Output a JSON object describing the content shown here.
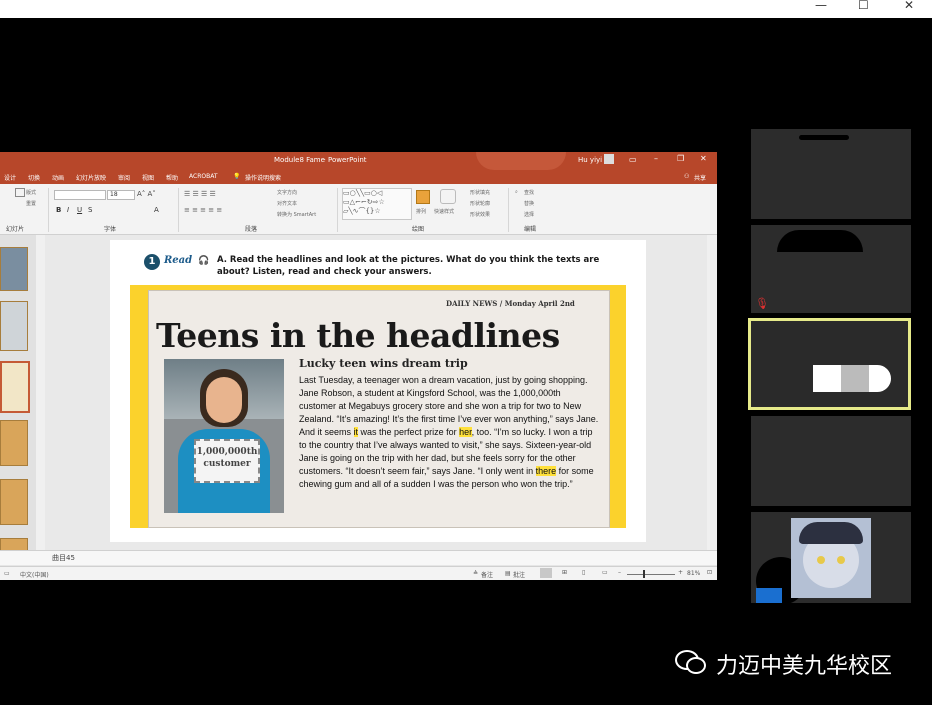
{
  "window": {
    "minimize": "—",
    "maximize": "☐",
    "close": "✕"
  },
  "ppt": {
    "filename": "Module8 Fame",
    "app": "PowerPoint",
    "user": "Hu yiyi",
    "menu": [
      "设计",
      "切换",
      "动画",
      "幻灯片放映",
      "审阅",
      "视图",
      "帮助",
      "ACROBAT"
    ],
    "tell_me": "操作说明搜索",
    "share": "共享",
    "ribbon": {
      "group_slides": "幻灯片",
      "group_font": "字体",
      "group_paragraph": "段落",
      "group_drawing": "绘图",
      "group_editing": "编辑",
      "layout": "版式",
      "reset": "重置",
      "font_size": "18",
      "text_direction": "文字方向",
      "align_text": "对齐文本",
      "convert_smartart": "转换为 SmartArt",
      "arrange": "排列",
      "quick_styles": "快速样式",
      "shape_fill": "形状填充",
      "shape_outline": "形状轮廓",
      "shape_effects": "形状效果",
      "find": "查找",
      "replace": "替换",
      "select": "选择"
    },
    "notes": "曲目45",
    "status_lang": "中文(中国)",
    "status_notes": "备注",
    "status_comments": "批注",
    "zoom": "81%"
  },
  "slide": {
    "number": "1",
    "read": "Read",
    "instruction": "A. Read the headlines and look at the pictures. What do you think the texts are about? Listen, read and check your answers.",
    "dateline": "DAILY NEWS / Monday April 2nd",
    "headline": "Teens in the headlines",
    "sign_line1": "1,000,000th",
    "sign_line2": "customer",
    "story_title": "Lucky teen wins dream trip",
    "story_a": "Last Tuesday, a teenager won a dream vacation, just by going shopping. Jane Robson, a student at Kingsford School, was the 1,000,000th customer at Megabuys grocery store and she won a trip for two to New Zealand. “It’s amazing! It’s the first time I’ve ever won anything,” says Jane. And it seems ",
    "hl_it": "it",
    "story_b": " was the perfect prize for ",
    "hl_her": "her",
    "story_c": ", too. “I’m so lucky. I won a trip to the country that I’ve always wanted to visit,” she says. Sixteen-year-old Jane is going on the trip with her dad, but she feels sorry for the other customers. “It doesn’t seem fair,” says Jane. “I only went in ",
    "hl_there": "there",
    "story_d": " for some chewing gum and all of a sudden I was the person who won the trip.”"
  },
  "watermark": "力迈中美九华校区",
  "colors": {
    "ppt_accent": "#b7472a",
    "highlight": "#ffe03a",
    "active_tile_border": "#e6ea8a"
  }
}
